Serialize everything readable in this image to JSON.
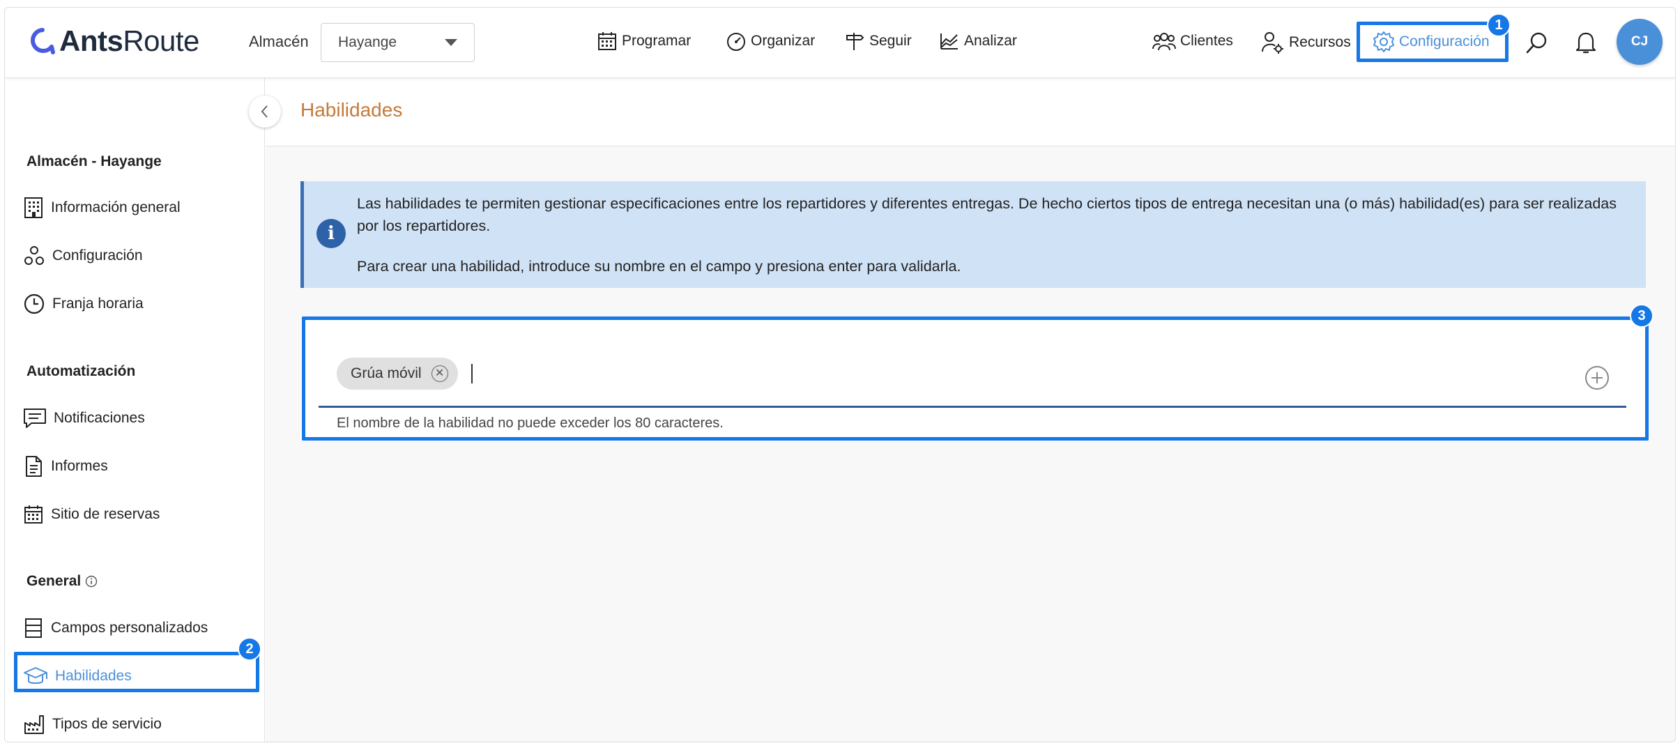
{
  "header": {
    "logo_bold": "Ants",
    "logo_light": "Route",
    "warehouse_label": "Almacén",
    "warehouse_value": "Hayange",
    "nav": [
      "Programar",
      "Organizar",
      "Seguir",
      "Analizar"
    ],
    "right_nav": [
      "Clientes",
      "Recursos",
      "Configuración"
    ],
    "avatar_initials": "CJ"
  },
  "annotations": [
    "1",
    "2",
    "3"
  ],
  "sidebar": {
    "warehouse_section": "Almacén - Hayange",
    "warehouse_items": [
      "Información general",
      "Configuración",
      "Franja horaria"
    ],
    "automation_section": "Automatización",
    "automation_items": [
      "Notificaciones",
      "Informes",
      "Sitio de reservas"
    ],
    "general_section": "General",
    "general_items": [
      "Campos personalizados",
      "Habilidades",
      "Tipos de servicio"
    ]
  },
  "main": {
    "title": "Habilidades",
    "info_line1": "Las habilidades te permiten gestionar especificaciones entre los repartidores y diferentes entregas. De hecho ciertos tipos de entrega necesitan una (o más) habilidad(es) para ser realizadas por los repartidores.",
    "info_line2": "Para crear una habilidad, introduce su nombre en el campo y presiona enter para validarla.",
    "chip_label": "Grúa móvil",
    "hint": "El nombre de la habilidad no puede exceder los 80 caracteres."
  },
  "colors": {
    "accent": "#4a90d9",
    "highlight": "#1677e6",
    "title": "#c47a3a",
    "info_bg": "#d0e2f6"
  }
}
